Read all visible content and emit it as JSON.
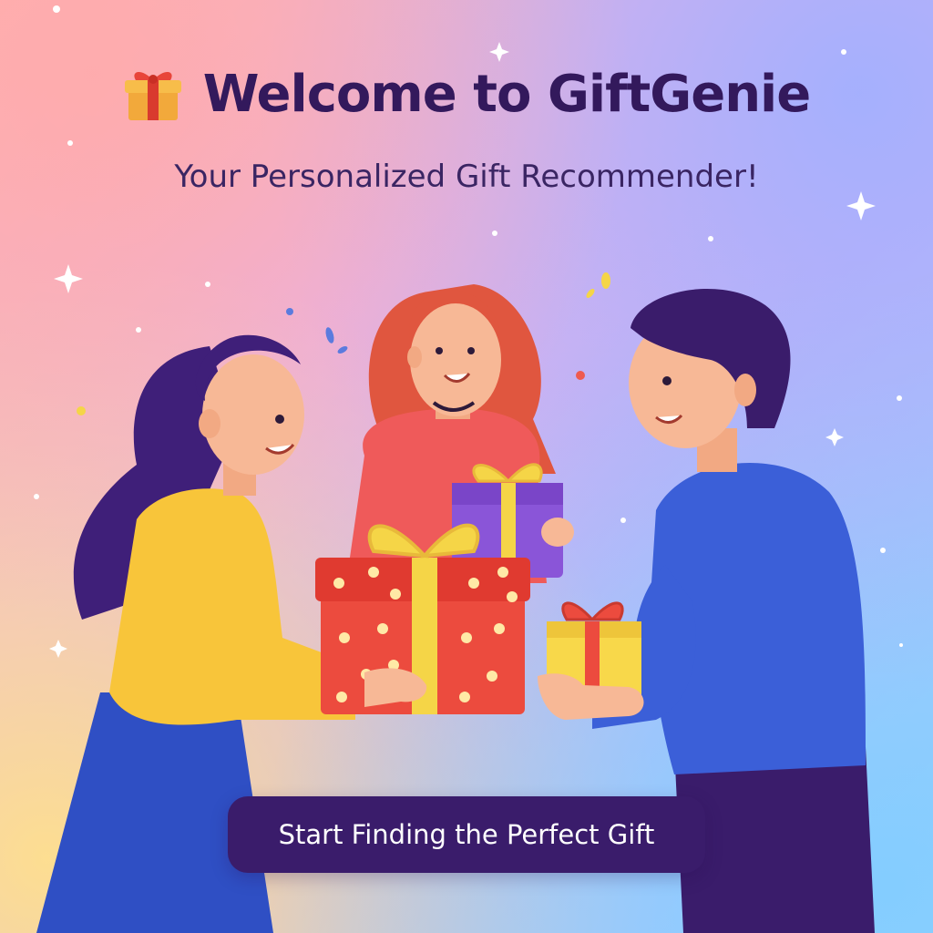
{
  "header": {
    "title": "Welcome to GiftGenie",
    "subtitle": "Your Personalized Gift Recommender!",
    "icon": "gift-icon"
  },
  "cta": {
    "label": "Start Finding the Perfect Gift"
  },
  "colors": {
    "title": "#33195c",
    "cta_background": "#3a1c6b",
    "cta_text": "#ffffff"
  }
}
